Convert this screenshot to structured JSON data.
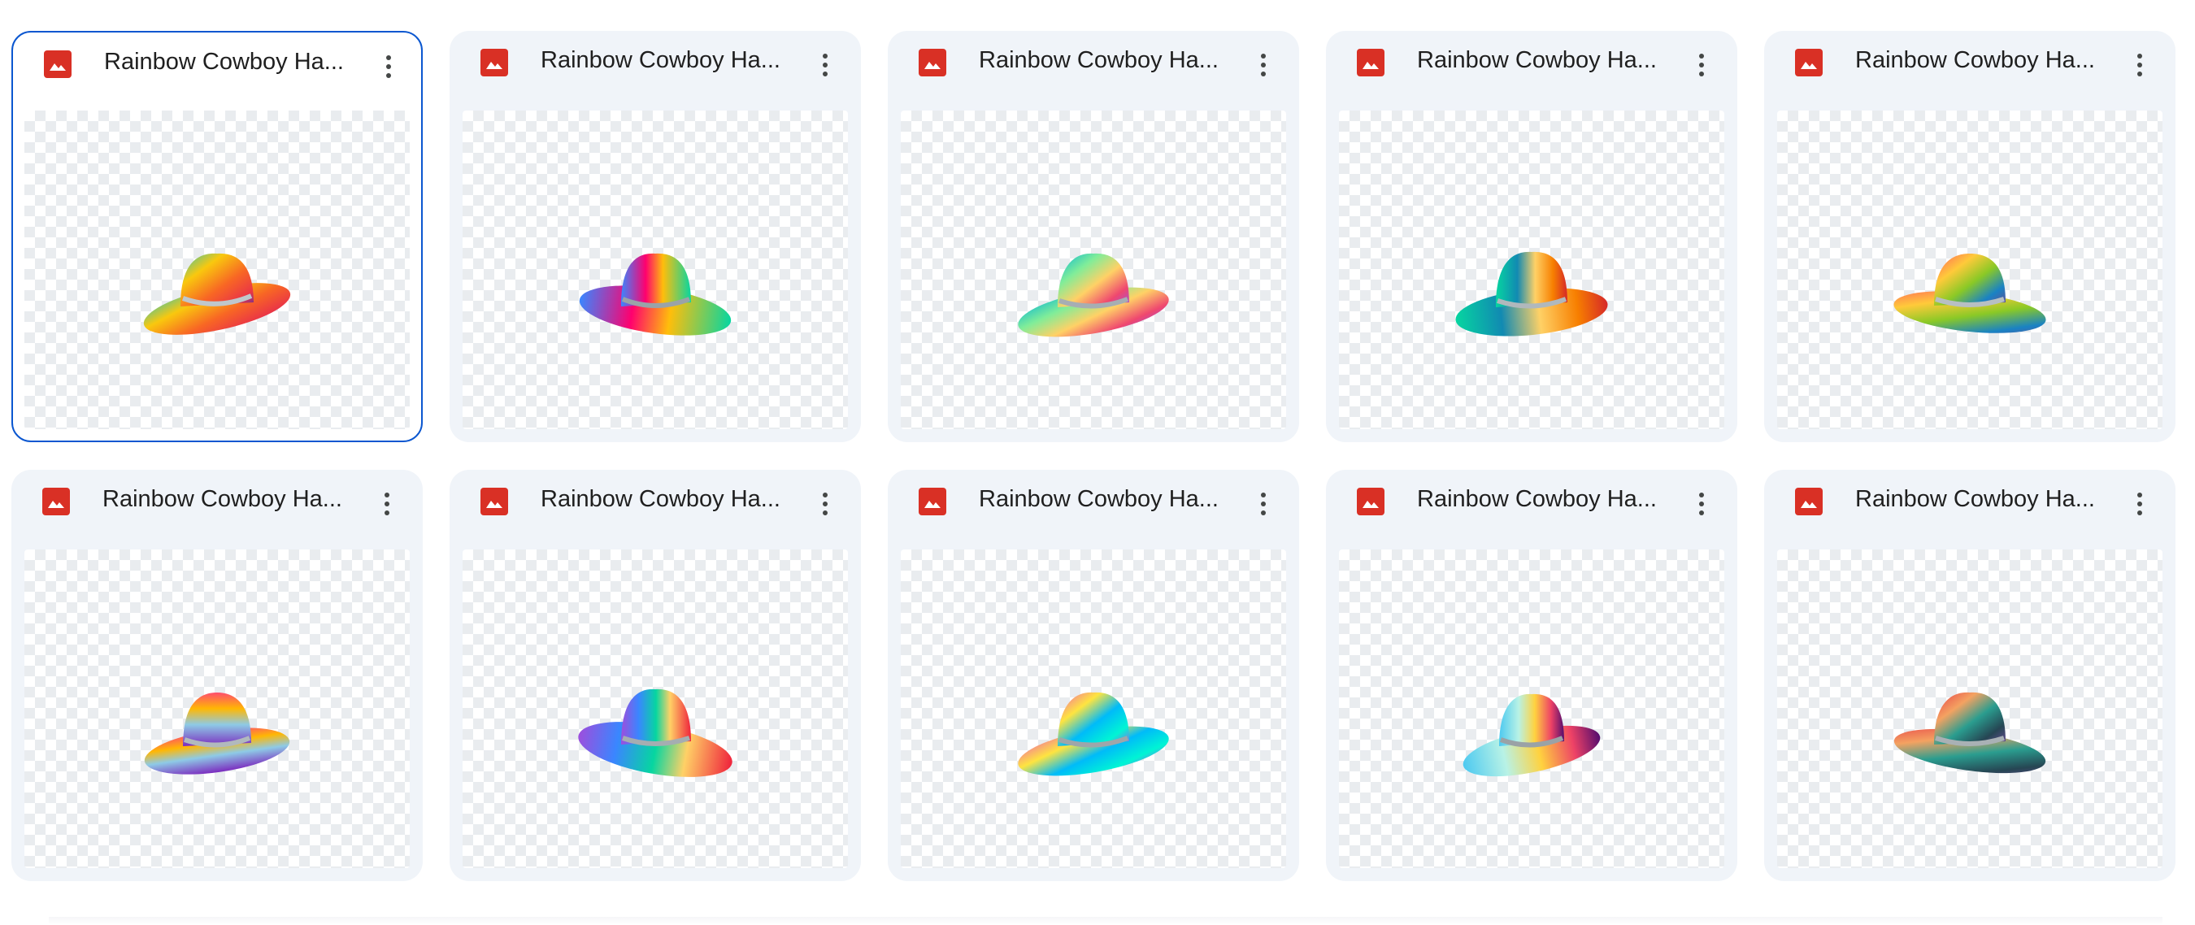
{
  "files": [
    {
      "title": "Rainbow Cowboy Ha...",
      "selected": true,
      "variant": 0
    },
    {
      "title": "Rainbow Cowboy Ha...",
      "selected": false,
      "variant": 1
    },
    {
      "title": "Rainbow Cowboy Ha...",
      "selected": false,
      "variant": 2
    },
    {
      "title": "Rainbow Cowboy Ha...",
      "selected": false,
      "variant": 3
    },
    {
      "title": "Rainbow Cowboy Ha...",
      "selected": false,
      "variant": 4
    },
    {
      "title": "Rainbow Cowboy Ha...",
      "selected": false,
      "variant": 5
    },
    {
      "title": "Rainbow Cowboy Ha...",
      "selected": false,
      "variant": 6
    },
    {
      "title": "Rainbow Cowboy Ha...",
      "selected": false,
      "variant": 7
    },
    {
      "title": "Rainbow Cowboy Ha...",
      "selected": false,
      "variant": 8
    },
    {
      "title": "Rainbow Cowboy Ha...",
      "selected": false,
      "variant": 9
    }
  ],
  "colors": {
    "card_bg": "#f0f4f9",
    "selected_border": "#0b57d0",
    "image_icon": "#d93025",
    "title_text": "#1f1f1f"
  },
  "icons": {
    "file_type": "image-file-icon",
    "more": "more-vert-icon"
  }
}
